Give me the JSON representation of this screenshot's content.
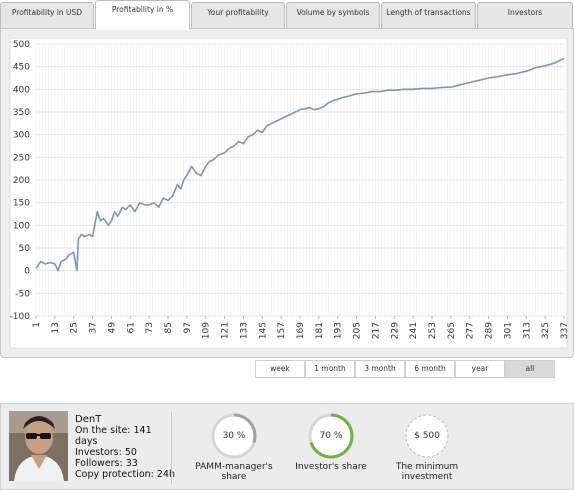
{
  "tabs": [
    {
      "label": "Profitability in USD",
      "active": false
    },
    {
      "label": "Profitability in %",
      "active": true
    },
    {
      "label": "Your profitability",
      "active": false
    },
    {
      "label": "Volume by symbols",
      "active": false
    },
    {
      "label": "Length of transactions",
      "active": false
    },
    {
      "label": "Investors",
      "active": false
    }
  ],
  "chart_data": {
    "type": "line",
    "title": "",
    "xlabel": "",
    "ylabel": "",
    "ylim": [
      -100,
      500
    ],
    "y_ticks": [
      500,
      450,
      400,
      350,
      300,
      250,
      200,
      150,
      100,
      50,
      0,
      -50,
      -100
    ],
    "x_ticks": [
      1,
      13,
      25,
      37,
      49,
      61,
      73,
      85,
      97,
      109,
      121,
      133,
      145,
      157,
      169,
      181,
      193,
      205,
      217,
      229,
      241,
      253,
      265,
      277,
      289,
      301,
      313,
      325,
      337
    ],
    "xlim": [
      1,
      337
    ],
    "grid": true,
    "line_color": "#7f96b0",
    "series": [
      {
        "x": [
          1,
          4,
          7,
          10,
          13,
          15,
          17,
          20,
          22,
          25,
          27,
          28,
          30,
          32,
          35,
          37,
          40,
          42,
          44,
          47,
          49,
          51,
          53,
          56,
          58,
          61,
          64,
          67,
          70,
          73,
          76,
          79,
          82,
          85,
          88,
          91,
          93,
          95,
          97,
          100,
          103,
          106,
          109,
          111,
          114,
          117,
          121,
          124,
          127,
          130,
          133,
          136,
          139,
          142,
          145,
          148,
          151,
          154,
          157,
          160,
          163,
          166,
          169,
          172,
          175,
          178,
          181,
          184,
          187,
          190,
          193,
          196,
          200,
          205,
          210,
          215,
          220,
          225,
          230,
          235,
          241,
          247,
          253,
          259,
          265,
          271,
          277,
          283,
          289,
          295,
          301,
          307,
          313,
          319,
          325,
          331,
          337
        ],
        "y": [
          5,
          20,
          15,
          18,
          15,
          0,
          20,
          25,
          35,
          40,
          0,
          70,
          80,
          75,
          80,
          75,
          130,
          110,
          115,
          100,
          110,
          130,
          120,
          140,
          135,
          145,
          130,
          150,
          145,
          145,
          150,
          140,
          160,
          155,
          165,
          190,
          180,
          200,
          210,
          230,
          215,
          210,
          230,
          240,
          245,
          255,
          260,
          270,
          275,
          285,
          280,
          295,
          300,
          310,
          305,
          320,
          325,
          330,
          335,
          340,
          345,
          350,
          355,
          357,
          360,
          355,
          357,
          362,
          370,
          375,
          378,
          382,
          385,
          390,
          392,
          395,
          395,
          398,
          398,
          400,
          400,
          402,
          402,
          404,
          405,
          410,
          415,
          420,
          425,
          428,
          432,
          435,
          440,
          448,
          452,
          458,
          468
        ]
      }
    ]
  },
  "periods": [
    {
      "label": "week",
      "active": false
    },
    {
      "label": "1 month",
      "active": false
    },
    {
      "label": "3 month",
      "active": false
    },
    {
      "label": "6 month",
      "active": false
    },
    {
      "label": "year",
      "active": false
    },
    {
      "label": "all",
      "active": true
    }
  ],
  "profile": {
    "name": "DenT",
    "on_site_line1": "On the site: 141",
    "on_site_line2": "days",
    "investors": "Investors: 50",
    "followers": "Followers: 33",
    "copy_protection": "Copy protection: 24h"
  },
  "stats": [
    {
      "value_label": "30 %",
      "caption_line1": "PAMM-manager's",
      "caption_line2": "share",
      "fraction": 0.3,
      "ring_color": "#a0a0a0",
      "dashed": false
    },
    {
      "value_label": "70 %",
      "caption_line1": "Investor's share",
      "caption_line2": "",
      "fraction": 0.7,
      "ring_color": "#6db33f",
      "dashed": false
    },
    {
      "value_label": "$ 500",
      "caption_line1": "The minimum",
      "caption_line2": "investment",
      "fraction": 0,
      "ring_color": "#bdbdbd",
      "dashed": true
    }
  ]
}
